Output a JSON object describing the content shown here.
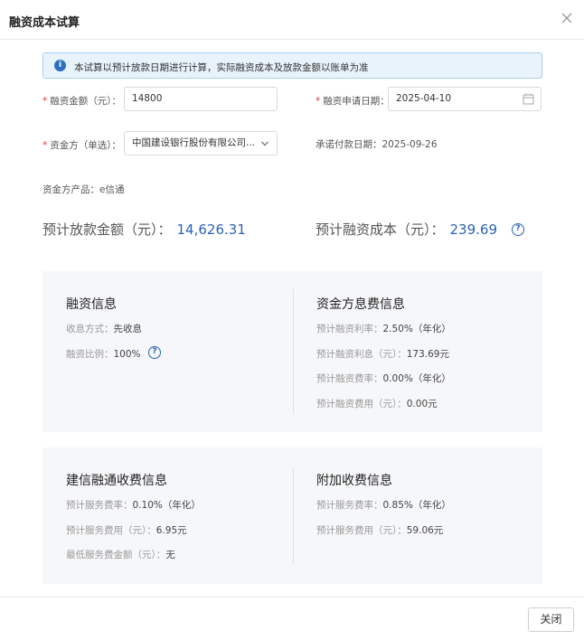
{
  "dialog": {
    "title": "融资成本试算",
    "close_button": "关闭"
  },
  "notice": {
    "text": "本试算以预计放款日期进行计算，实际融资成本及放款金额以账单为准"
  },
  "form": {
    "amount_label": "融资金额（元）：",
    "amount_value": "14800",
    "date_label": "融资申请日期：",
    "date_value": "2025-04-10",
    "funder_label": "资金方（单选）：",
    "funder_value": "中国建设银行股份有限公司...",
    "commit_date_label": "承诺付款日期：",
    "commit_date_value": "2025-09-26",
    "product_label": "资金方产品：",
    "product_value": "e信通"
  },
  "summary": {
    "loan_label": "预计放款金额（元）：",
    "loan_value": "14,626.31",
    "cost_label": "预计融资成本（元）：",
    "cost_value": "239.69"
  },
  "financing_info": {
    "title": "融资信息",
    "items": [
      {
        "k": "收息方式：",
        "v": "先收息"
      },
      {
        "k": "融资比例：",
        "v": "100%"
      }
    ]
  },
  "funder_fee_info": {
    "title": "资金方息费信息",
    "items": [
      {
        "k": "预计融资利率：",
        "v": "2.50%（年化）"
      },
      {
        "k": "预计融资利息（元）：",
        "v": "173.69元"
      },
      {
        "k": "预计融资费率：",
        "v": "0.00%（年化）"
      },
      {
        "k": "预计融资费用（元）：",
        "v": "0.00元"
      }
    ]
  },
  "platform_fee_info": {
    "title": "建信融通收费信息",
    "items": [
      {
        "k": "预计服务费率：",
        "v": "0.10%（年化）"
      },
      {
        "k": "预计服务费用（元）：",
        "v": "6.95元"
      },
      {
        "k": "最低服务费金额（元）：",
        "v": "无"
      }
    ]
  },
  "extra_fee_info": {
    "title": "附加收费信息",
    "items": [
      {
        "k": "预计服务费率：",
        "v": "0.85%（年化）"
      },
      {
        "k": "预计服务费用（元）：",
        "v": "59.06元"
      }
    ]
  },
  "colors": {
    "accent": "#2a62b8",
    "required": "#e53935",
    "notice_bg": "#e8f3fb",
    "card_bg": "#f6f7f9"
  },
  "icons": {
    "info": "info-icon",
    "help": "help-circle-icon",
    "calendar": "calendar-icon",
    "chevron": "chevron-down-icon",
    "close": "close-icon"
  }
}
